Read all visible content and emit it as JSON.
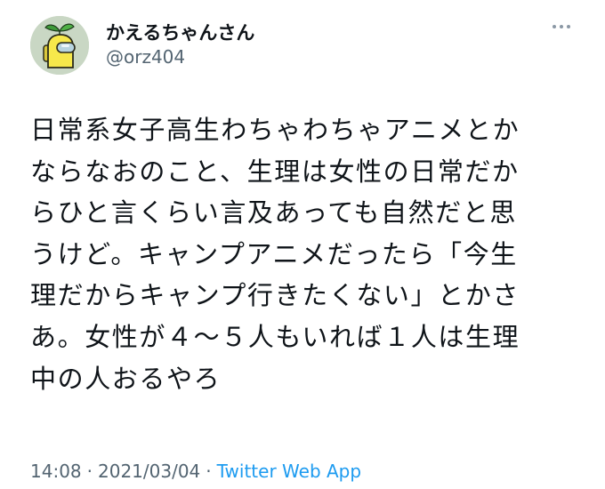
{
  "user": {
    "display_name": "かえるちゃんさん",
    "handle": "@orz404",
    "avatar_icon": "frog-crewmate-avatar",
    "avatar_colors": {
      "background": "#c9d7c4",
      "body": "#f6e84b",
      "visor": "#b7d4df",
      "leaf": "#3f9a3a"
    }
  },
  "menu": {
    "icon": "more-options-icon"
  },
  "tweet": {
    "lines": [
      "日常系女子高生わちゃわちゃアニメとか",
      "ならなおのこと、生理は女性の日常だか",
      "らひと言くらい言及あっても自然だと思",
      "うけど。キャンプアニメだったら「今生",
      "理だからキャンプ行きたくない」とかさ",
      "あ。女性が４〜５人もいれば１人は生理",
      "中の人おるやろ"
    ]
  },
  "meta": {
    "time": "14:08",
    "separator": "·",
    "date": "2021/03/04",
    "source": "Twitter Web App"
  },
  "colors": {
    "text": "#0f1419",
    "secondary": "#536471",
    "link": "#1d9bf0"
  }
}
